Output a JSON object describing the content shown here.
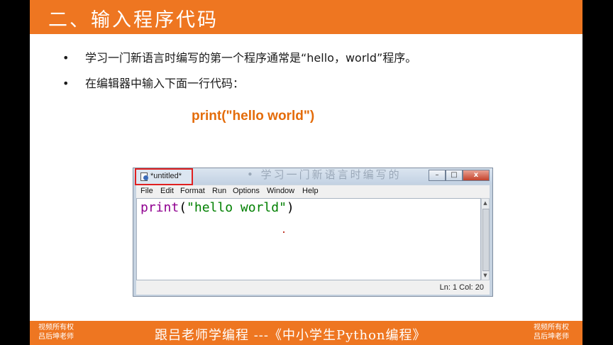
{
  "slide": {
    "title": "二、输入程序代码",
    "bullets": [
      "学习一门新语言时编写的第一个程序通常是“hello，world”程序。",
      "在编辑器中输入下面一行代码："
    ],
    "code_example": "print(\"hello world\")"
  },
  "editor_window": {
    "tab_title": "*untitled*",
    "menu": [
      "File",
      "Edit",
      "Format",
      "Run",
      "Options",
      "Window",
      "Help"
    ],
    "code": {
      "func": "print",
      "open": "(",
      "string": "\"hello world\"",
      "close": ")"
    },
    "status": "Ln: 1   Col: 20",
    "buttons": {
      "minimize": "–",
      "maximize": "□",
      "close": "x"
    }
  },
  "footer": {
    "text": "跟吕老师学编程 ---《中小学生Python编程》",
    "watermark_line1": "视频所有权",
    "watermark_line2": "吕后坤老师"
  },
  "colors": {
    "accent": "#ee7621",
    "code_orange": "#e46c0a",
    "keyword": "#900090",
    "string": "#008000"
  }
}
